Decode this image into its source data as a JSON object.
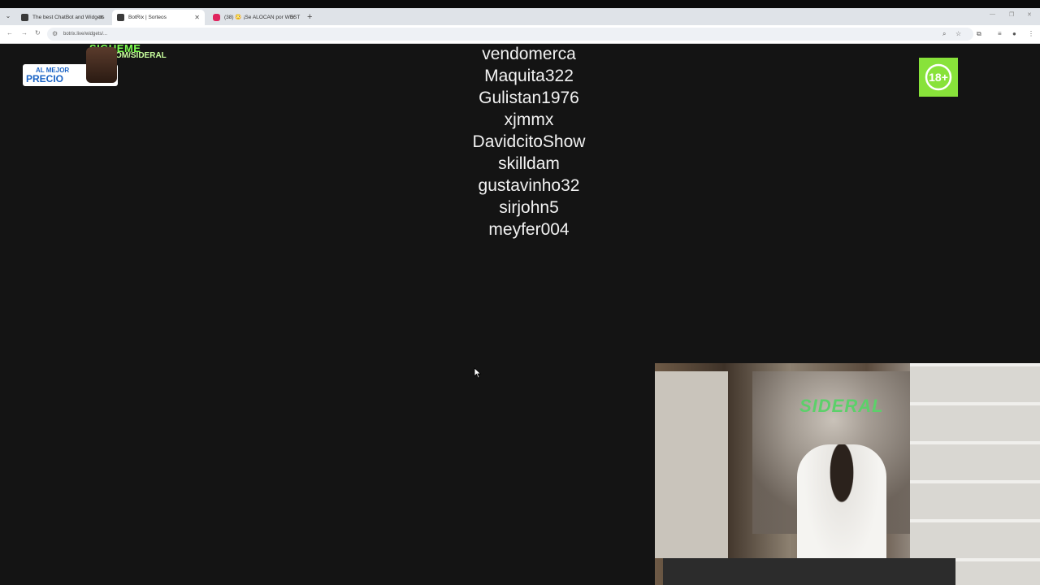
{
  "browser": {
    "tabs": [
      {
        "title": "The best ChatBot and Widgets",
        "active": false
      },
      {
        "title": "BotRix | Sorteos",
        "active": true
      },
      {
        "title": "(38) 😳 ¡Se ALOCAN por WEST",
        "active": false
      }
    ],
    "url": "botrix.live/widgets/...",
    "new_tab_label": "+"
  },
  "overlay": {
    "brand_line1": "SIGUEME",
    "brand_line2": ".COM/SIDERAL",
    "promo_line1": "AL MEJOR",
    "promo_line2": "PRECIO",
    "age_badge": "18+"
  },
  "winners": [
    "vendomerca",
    "Maquita322",
    "Gulistan1976",
    "xjmmx",
    "DavidcitoShow",
    "skilldam",
    "gustavinho32",
    "sirjohn5",
    "meyfer004"
  ],
  "webcam": {
    "logo_text": "SIDERAL"
  },
  "colors": {
    "background": "#141414",
    "accent_green": "#88e23a",
    "text": "#f2f2f2"
  }
}
